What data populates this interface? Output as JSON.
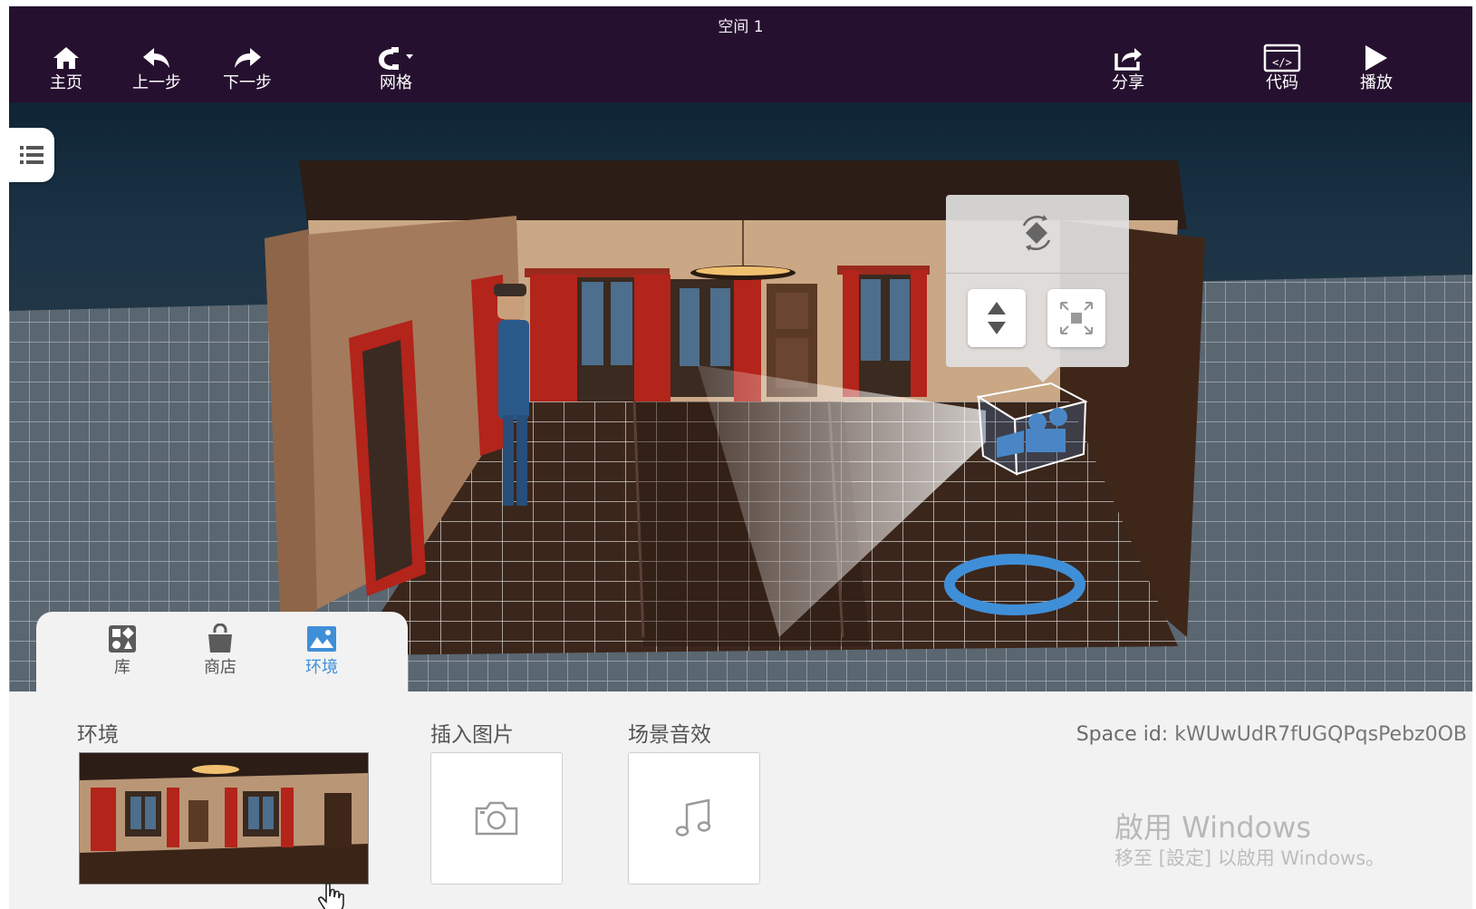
{
  "topbar": {
    "title": "空间 1",
    "home_label": "主页",
    "undo_label": "上一步",
    "redo_label": "下一步",
    "grid_label": "网格",
    "share_label": "分享",
    "code_label": "代码",
    "play_label": "播放",
    "background_color": "#26102f"
  },
  "tabs": [
    {
      "label": "库",
      "icon": "library-icon",
      "active": false
    },
    {
      "label": "商店",
      "icon": "shop-bag-icon",
      "active": false
    },
    {
      "label": "环境",
      "icon": "environment-image-icon",
      "active": true
    }
  ],
  "panel": {
    "environment_title": "环境",
    "insert_image_title": "插入图片",
    "sound_title": "场景音效",
    "space_id_label": "Space id:",
    "space_id_value": "kWUwUdR7fUGQPqsPebz0OB"
  },
  "watermark": {
    "title": "啟用 Windows",
    "subtitle": "移至 [設定] 以啟用 Windows。"
  },
  "colors": {
    "accent_blue": "#3f8fd8",
    "curtain_red": "#b3241b"
  }
}
